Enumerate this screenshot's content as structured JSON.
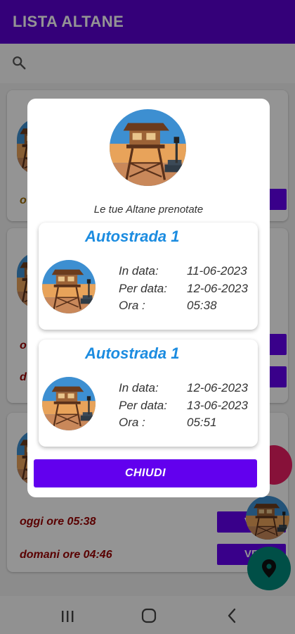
{
  "appbar": {
    "title": "LISTA ALTANE"
  },
  "background": {
    "card1_partial": "o",
    "card2_partial_1": "o",
    "card2_partial_2": "d",
    "card3_line1": "oggi ore 05:38",
    "card3_line2": "domani ore 04:46",
    "button_label_partial": "VE"
  },
  "dialog": {
    "subtitle": "Le tue Altane prenotate",
    "reservations": [
      {
        "title": "Autostrada 1",
        "in_label": "In data:",
        "in_value": "11-06-2023",
        "per_label": "Per data:",
        "per_value": "12-06-2023",
        "ora_label": "Ora :",
        "ora_value": "05:38"
      },
      {
        "title": "Autostrada 1",
        "in_label": "In data:",
        "in_value": "12-06-2023",
        "per_label": "Per data:",
        "per_value": "13-06-2023",
        "ora_label": "Ora :",
        "ora_value": "05:51"
      }
    ],
    "close_label": "CHIUDI"
  },
  "colors": {
    "primary": "#6200ee",
    "appbar": "#5a00d1",
    "title_blue": "#1c8ce0",
    "fab_teal": "#00897b",
    "fab_pink": "#e91e63",
    "time_text": "#9a0000"
  },
  "icons": {
    "search": "search-icon",
    "location": "location-pin-icon",
    "nav_recent": "recents-icon",
    "nav_home": "home-icon",
    "nav_back": "back-icon"
  }
}
